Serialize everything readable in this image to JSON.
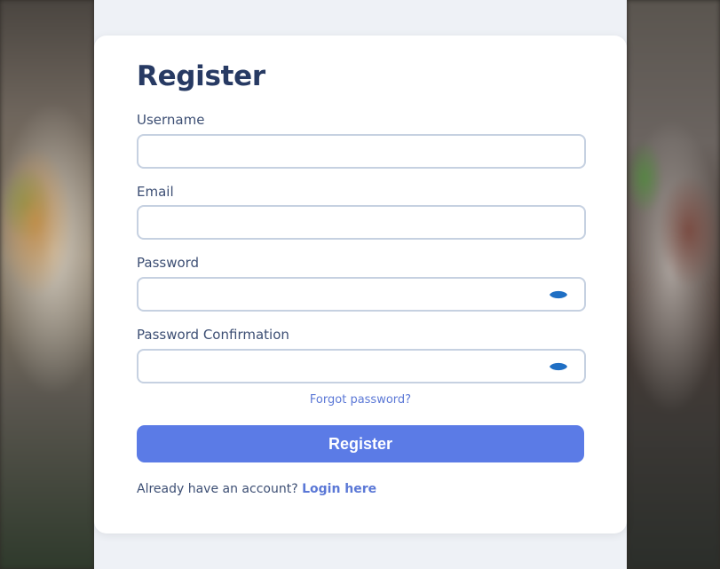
{
  "form": {
    "title": "Register",
    "fields": [
      {
        "label": "Username",
        "value": "",
        "placeholder": ""
      },
      {
        "label": "Email",
        "value": "",
        "placeholder": ""
      },
      {
        "label": "Password",
        "value": "",
        "placeholder": "",
        "toggle_icon": "eye-icon"
      },
      {
        "label": "Password Confirmation",
        "value": "",
        "placeholder": "",
        "toggle_icon": "eye-icon"
      }
    ],
    "forgot_password": "Forgot password?",
    "submit_label": "Register",
    "login_prompt": "Already have an account?",
    "login_link": "Login here"
  },
  "colors": {
    "title": "#273a63",
    "accent": "#5b7be6",
    "link": "#5b78d6",
    "eye_icon": "#1f6fc4",
    "input_border": "#c6d1e1",
    "page_bg": "#eef1f6"
  }
}
